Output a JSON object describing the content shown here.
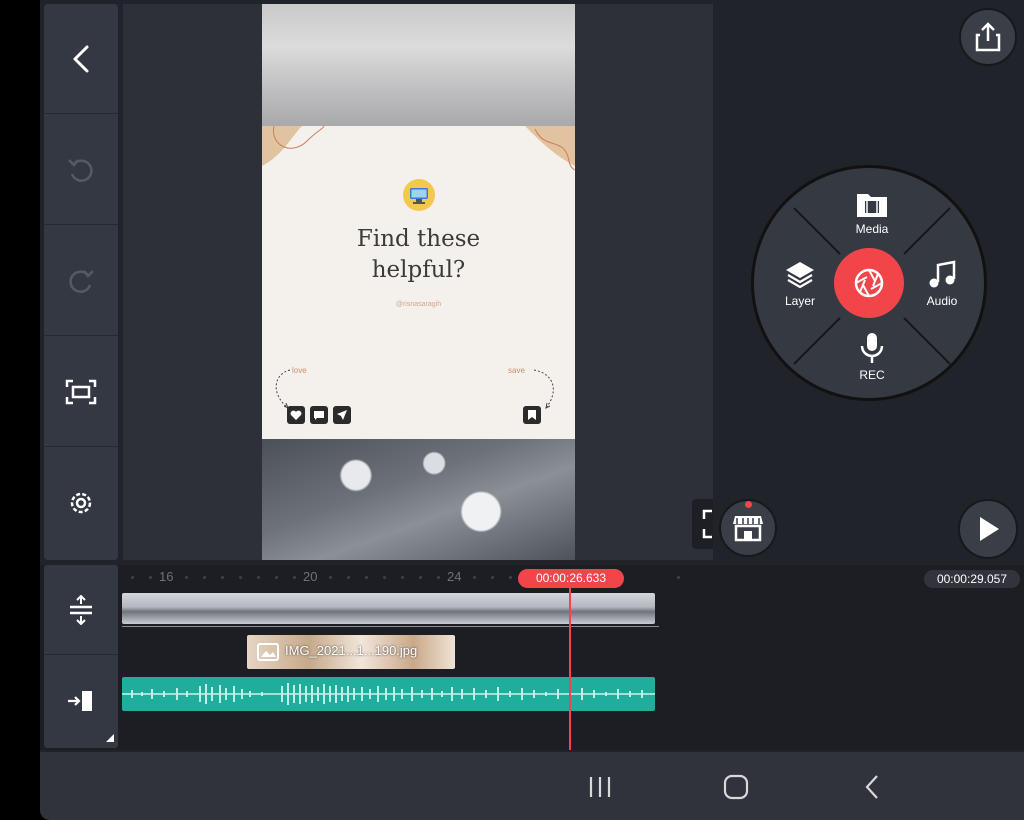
{
  "toolbar": {
    "back": "back-arrow-icon",
    "undo": "undo-icon",
    "redo": "redo-icon",
    "capture": "screen-capture-icon",
    "settings": "settings-gear-icon"
  },
  "preview": {
    "card_title": "Find these\nhelpful?",
    "card_handle": "@risnasaragih",
    "label_love": "love",
    "label_save": "save"
  },
  "menu": {
    "media": "Media",
    "layer": "Layer",
    "audio": "Audio",
    "rec": "REC"
  },
  "timeline": {
    "ticks": [
      "16",
      "20",
      "24"
    ],
    "playhead_time": "00:00:26.633",
    "total_time": "00:00:29.057",
    "image_clip_label": "IMG_2021...1...190.jpg"
  },
  "colors": {
    "accent": "#f2454a",
    "audio_track": "#1fae9b",
    "panel": "#343842",
    "background": "#20232a"
  }
}
